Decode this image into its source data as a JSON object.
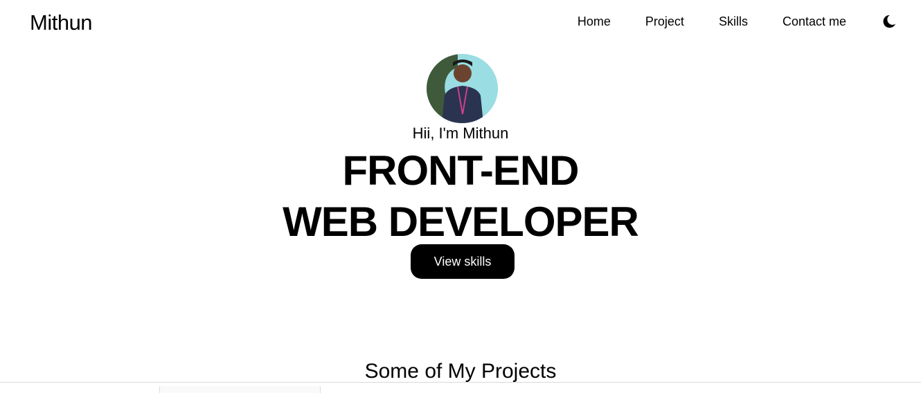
{
  "header": {
    "logo": "Mithun",
    "nav": [
      "Home",
      "Project",
      "Skills",
      "Contact me"
    ],
    "theme_icon": "moon-icon"
  },
  "hero": {
    "greeting": "Hii, I'm Mithun",
    "title_line1": "FRONT-END",
    "title_line2": "WEB DEVELOPER",
    "cta": "View skills"
  },
  "projects": {
    "heading": "Some of My Projects"
  }
}
